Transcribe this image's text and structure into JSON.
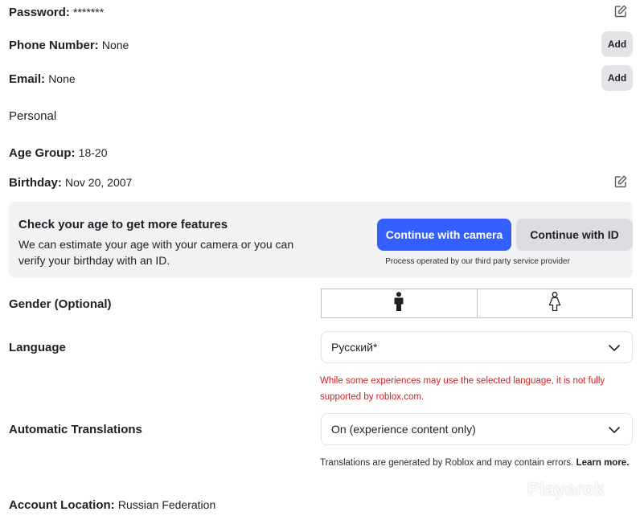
{
  "account": {
    "password_label": "Password:",
    "password_value": "*******",
    "phone_label": "Phone Number:",
    "phone_value": "None",
    "phone_add": "Add",
    "email_label": "Email:",
    "email_value": "None",
    "email_add": "Add"
  },
  "personal": {
    "section_title": "Personal",
    "age_group_label": "Age Group:",
    "age_group_value": "18-20",
    "birthday_label": "Birthday:",
    "birthday_value": "Nov 20, 2007"
  },
  "age_check": {
    "title": "Check your age to get more features",
    "description": "We can estimate your age with your camera or you can verify your birthday with an ID.",
    "camera_button": "Continue with camera",
    "id_button": "Continue with ID",
    "provider_note": "Process operated by our third party service provider",
    "camera_color": "#335fff"
  },
  "gender": {
    "label": "Gender (Optional)",
    "options": [
      "male-icon",
      "female-icon"
    ]
  },
  "language": {
    "label": "Language",
    "selected": "Русский*",
    "warning": "While some experiences may use the selected language, it is not fully supported by roblox.com.",
    "warning_color": "#d3201f"
  },
  "translations": {
    "label": "Automatic Translations",
    "selected": "On (experience content only)",
    "note": "Translations are generated by Roblox and may contain errors.",
    "learn_more": "Learn more."
  },
  "location": {
    "label": "Account Location:",
    "value": "Russian Federation"
  },
  "watermark": "Playerok"
}
